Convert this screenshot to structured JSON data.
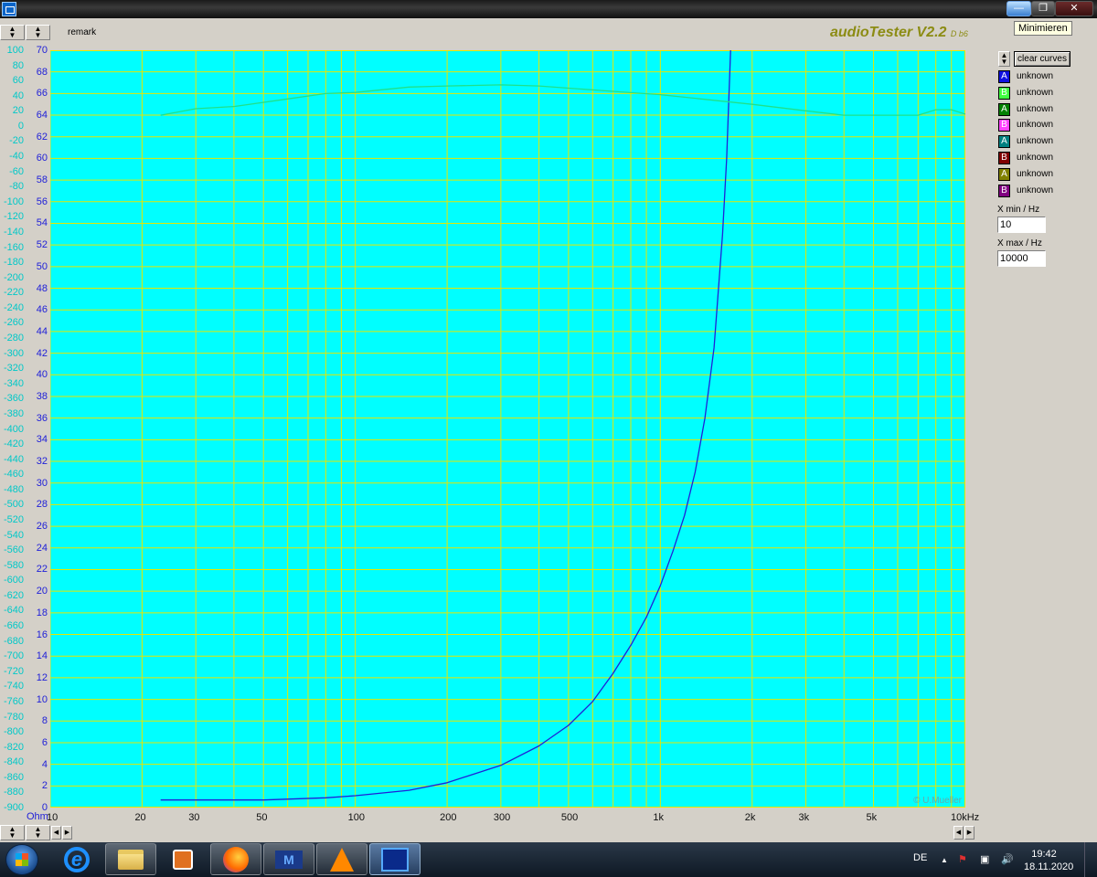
{
  "window": {
    "tooltip": "Minimieren"
  },
  "header": {
    "remark": "remark",
    "brand_main": "audioTester V2.2",
    "brand_sub": "D b6"
  },
  "colors": {
    "plot_background": "#00ffff",
    "grid": "#e6e600",
    "curve_impedance": "#2020d8",
    "curve_phase": "#20e08a",
    "axis_left_text": "#00c8c8",
    "axis_right_text": "#2020d8",
    "brand": "#8c8c14"
  },
  "chart_data": {
    "type": "line",
    "xscale": "log",
    "xlim": [
      10,
      10000
    ],
    "y_right_label": "Ohm",
    "y_right_lim": [
      0,
      70
    ],
    "y_left_lim": [
      -900,
      100
    ],
    "x_ticks": [
      "10",
      "20",
      "30",
      "50",
      "100",
      "200",
      "300",
      "500",
      "1k",
      "2k",
      "3k",
      "5k",
      "10kHz"
    ],
    "y_right_ticks": [
      "70",
      "68",
      "66",
      "64",
      "62",
      "60",
      "58",
      "56",
      "54",
      "52",
      "50",
      "48",
      "46",
      "44",
      "42",
      "40",
      "38",
      "36",
      "34",
      "32",
      "30",
      "28",
      "26",
      "24",
      "22",
      "20",
      "18",
      "16",
      "14",
      "12",
      "10",
      "8",
      "6",
      "4",
      "2",
      "0"
    ],
    "y_left_ticks": [
      "100",
      "80",
      "60",
      "40",
      "20",
      "0",
      "-20",
      "-40",
      "-60",
      "-80",
      "-100",
      "-120",
      "-140",
      "-160",
      "-180",
      "-200",
      "-220",
      "-240",
      "-260",
      "-280",
      "-300",
      "-320",
      "-340",
      "-360",
      "-380",
      "-400",
      "-420",
      "-440",
      "-460",
      "-480",
      "-500",
      "-520",
      "-540",
      "-560",
      "-580",
      "-600",
      "-620",
      "-640",
      "-660",
      "-680",
      "-700",
      "-720",
      "-740",
      "-760",
      "-780",
      "-800",
      "-820",
      "-840",
      "-860",
      "-880",
      "-900"
    ],
    "grid": true,
    "series": [
      {
        "axis": "right",
        "x": [
          23,
          50,
          80,
          100,
          150,
          200,
          300,
          400,
          500,
          600,
          700,
          800,
          900,
          1000,
          1100,
          1200,
          1300,
          1400,
          1500,
          1600,
          1650,
          1700
        ],
        "y": [
          0.7,
          0.7,
          0.9,
          1.1,
          1.6,
          2.3,
          3.9,
          5.7,
          7.6,
          9.8,
          12.4,
          15.0,
          17.6,
          20.5,
          23.7,
          27.0,
          31.0,
          36.0,
          42.5,
          53.0,
          60.0,
          70.0
        ]
      },
      {
        "axis": "right",
        "x": [
          23,
          30,
          40,
          60,
          80,
          100,
          150,
          200,
          300,
          400,
          500,
          700,
          1000,
          2000,
          3000,
          4000,
          5000,
          6000,
          7000,
          8000,
          9000,
          10000
        ],
        "y": [
          64.0,
          64.6,
          64.8,
          65.5,
          66.0,
          66.1,
          66.6,
          66.7,
          66.8,
          66.7,
          66.5,
          66.2,
          65.9,
          65.0,
          64.4,
          64.0,
          64.0,
          64.0,
          64.0,
          64.5,
          64.5,
          64.1
        ]
      }
    ]
  },
  "plot": {
    "copyright": "© U.Mueller"
  },
  "legend": {
    "clear_label": "clear curves",
    "items": [
      {
        "letter": "A",
        "label": "unknown",
        "bg": "#1010e0",
        "fg": "#ffffff"
      },
      {
        "letter": "B",
        "label": "unknown",
        "bg": "#40ff40",
        "fg": "#ffffff"
      },
      {
        "letter": "A",
        "label": "unknown",
        "bg": "#008000",
        "fg": "#ffffff"
      },
      {
        "letter": "B",
        "label": "unknown",
        "bg": "#ff40ff",
        "fg": "#ffffff"
      },
      {
        "letter": "A",
        "label": "unknown",
        "bg": "#008080",
        "fg": "#ffffff"
      },
      {
        "letter": "B",
        "label": "unknown",
        "bg": "#800000",
        "fg": "#ffffff"
      },
      {
        "letter": "A",
        "label": "unknown",
        "bg": "#808000",
        "fg": "#ffffff"
      },
      {
        "letter": "B",
        "label": "unknown",
        "bg": "#800080",
        "fg": "#ffffff"
      }
    ]
  },
  "range": {
    "xmin_label": "X min / Hz",
    "xmin_value": "10",
    "xmax_label": "X max / Hz",
    "xmax_value": "10000"
  },
  "taskbar": {
    "language": "DE",
    "time": "19:42",
    "date": "18.11.2020",
    "ie_glyph": "e",
    "m_glyph": "M",
    "tray_up": "▲",
    "tray_flag": "⚑",
    "tray_network": "▣",
    "tray_volume": "🔊"
  }
}
